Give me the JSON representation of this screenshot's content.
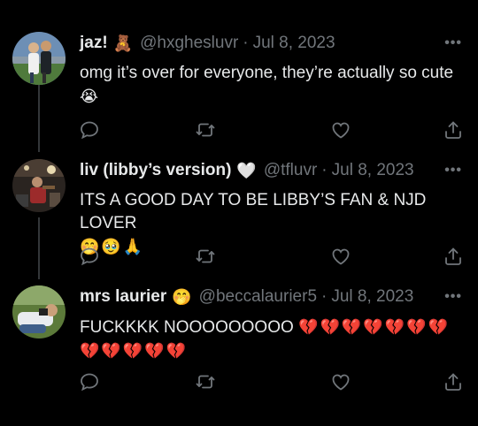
{
  "tweets": [
    {
      "display_name": "jaz!",
      "badge_emoji": "🧸",
      "handle": "@hxghesluvr",
      "separator": "·",
      "date": "Jul 8, 2023",
      "text": "omg it’s over for everyone, they’re actually so cute",
      "emojis": "😭",
      "avatar_icon": "two-people-photo"
    },
    {
      "display_name": "liv (libby’s version)",
      "badge_emoji": "🤍",
      "handle": "@tfluvr",
      "separator": "·",
      "date": "Jul 8, 2023",
      "text": "ITS A GOOD DAY TO BE LIBBY’S FAN & NJD LOVER",
      "emojis": "🤭🥹🙏",
      "avatar_icon": "stage-photo"
    },
    {
      "display_name": "mrs laurier",
      "badge_emoji": "🤭",
      "handle": "@beccalaurier5",
      "separator": "·",
      "date": "Jul 8, 2023",
      "text": "FUCKKKK NOOOOOOOOO",
      "emojis": "💔💔💔💔💔💔💔💔💔💔💔💔",
      "avatar_icon": "person-lying-photo"
    }
  ],
  "more_label": "•••",
  "icons": {
    "reply": "reply-icon",
    "retweet": "retweet-icon",
    "like": "heart-icon",
    "share": "share-icon"
  },
  "colors": {
    "background": "#000000",
    "text": "#e7e9ea",
    "muted": "#71767b"
  }
}
